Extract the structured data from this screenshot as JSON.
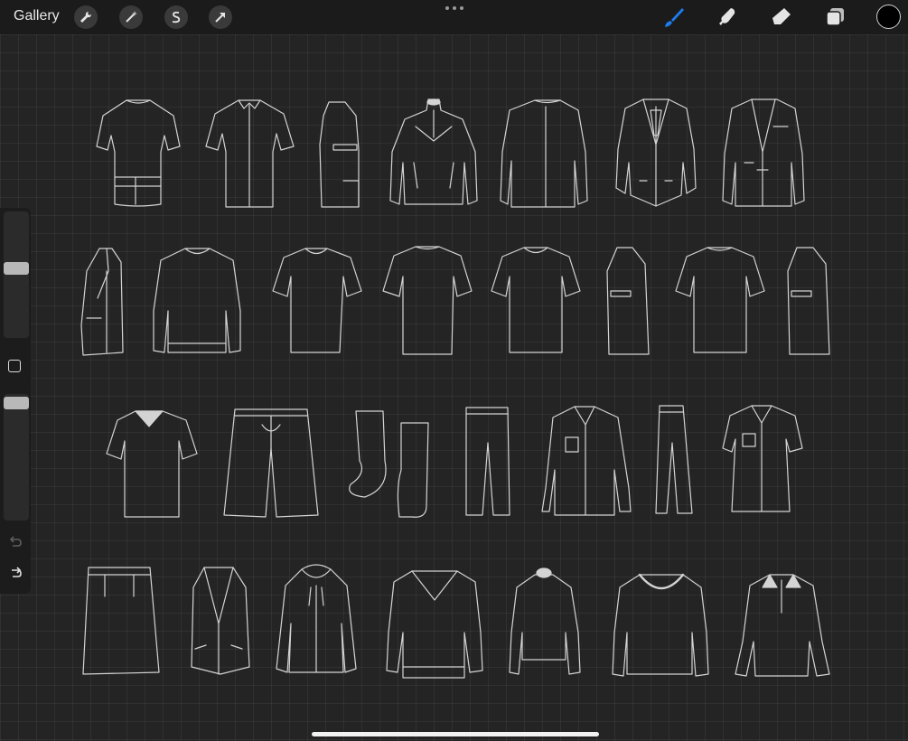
{
  "topbar": {
    "gallery_label": "Gallery",
    "left_tools": [
      "wrench-icon",
      "magic-wand-icon",
      "selection-icon",
      "transform-arrow-icon"
    ],
    "right_tools": [
      "brush-icon",
      "smudge-icon",
      "eraser-icon",
      "layers-icon"
    ],
    "active_tool": "brush-icon",
    "current_color": "#000000",
    "accent_color": "#1c7cf2"
  },
  "sidebar": {
    "brush_size_slider": "brush-size-slider",
    "opacity_slider": "opacity-slider",
    "modify_button": "modify-button",
    "undo": "undo-icon",
    "redo": "redo-icon"
  },
  "canvas": {
    "artwork_rows": [
      [
        "jersey-back",
        "jersey-front",
        "jersey-side",
        "half-zip-pullover",
        "blazer-back",
        "suit-vest-tie",
        "blazer-front"
      ],
      [
        "blazer-side",
        "crewneck-sweater",
        "tshirt-front",
        "tshirt-back",
        "tshirt-crew",
        "tshirt-side",
        "tshirt-front-2",
        "tshirt-side-2"
      ],
      [
        "vneck-tshirt",
        "shorts",
        "socks",
        "trousers",
        "womens-shirt",
        "slim-trousers",
        "short-sleeve-blouse"
      ],
      [
        "pencil-skirt",
        "waistcoat",
        "zip-hoodie",
        "vneck-sweater",
        "turtleneck",
        "scoop-neck-top",
        "polo-long-sleeve"
      ]
    ]
  }
}
